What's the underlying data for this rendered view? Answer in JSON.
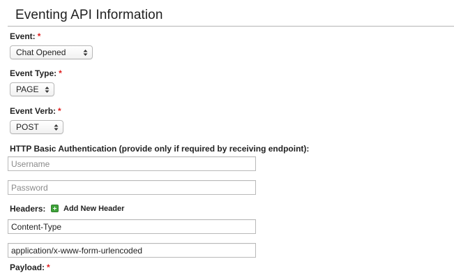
{
  "section": {
    "title": "Eventing API Information"
  },
  "event": {
    "label": "Event:",
    "required_mark": "*",
    "selected": "Chat Opened"
  },
  "event_type": {
    "label": "Event Type:",
    "required_mark": "*",
    "selected": "PAGE"
  },
  "event_verb": {
    "label": "Event Verb:",
    "required_mark": "*",
    "selected": "POST"
  },
  "auth": {
    "label": "HTTP Basic Authentication (provide only if required by receiving endpoint):",
    "username_placeholder": "Username",
    "password_placeholder": "Password"
  },
  "headers": {
    "label": "Headers:",
    "add_label": "Add New Header",
    "add_icon": "plus-square-icon",
    "name_value": "Content-Type",
    "value_value": "application/x-www-form-urlencoded"
  },
  "payload": {
    "label": "Payload:",
    "required_mark": "*"
  },
  "colors": {
    "required": "#e02020",
    "add_icon": "#3fa33a"
  }
}
